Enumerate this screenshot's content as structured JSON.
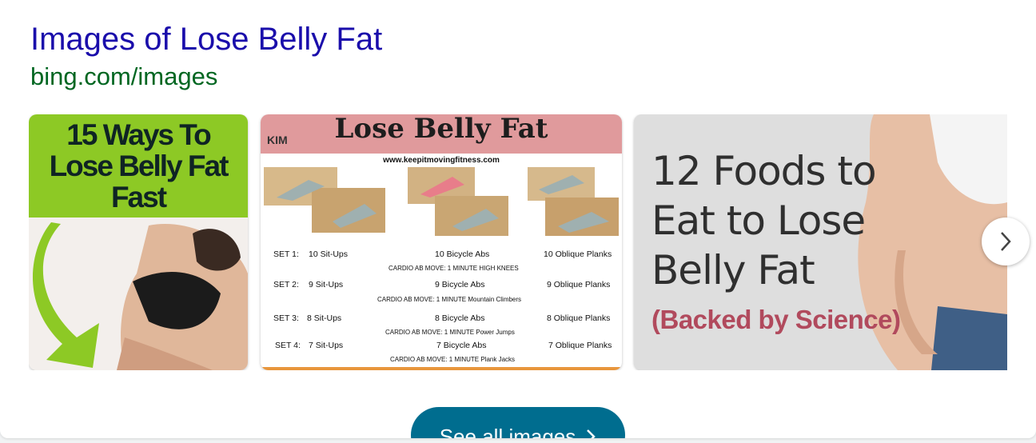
{
  "result": {
    "title": "Images of Lose Belly Fat",
    "url": "bing.com/images"
  },
  "thumbnails": [
    {
      "lines": [
        "15 Ways To",
        "Lose Belly Fat",
        "Fast"
      ]
    },
    {
      "heading": "Lose Belly Fat",
      "site": "www.keepitmovingfitness.com",
      "logo": "KIM",
      "sets": [
        {
          "label": "SET 1:",
          "a": "10 Sit-Ups",
          "b": "10 Bicycle Abs",
          "c": "10 Oblique Planks",
          "cardio": "CARDIO AB MOVE: 1 MINUTE  HIGH KNEES"
        },
        {
          "label": "SET 2:",
          "a": "9 Sit-Ups",
          "b": "9 Bicycle Abs",
          "c": "9 Oblique Planks",
          "cardio": "CARDIO AB MOVE: 1 MINUTE  Mountain Climbers"
        },
        {
          "label": "SET 3:",
          "a": "8 Sit-Ups",
          "b": "8 Bicycle Abs",
          "c": "8 Oblique Planks",
          "cardio": "CARDIO AB MOVE: 1 MINUTE  Power Jumps"
        },
        {
          "label": "SET 4:",
          "a": "7 Sit-Ups",
          "b": "7 Bicycle Abs",
          "c": "7 Oblique Planks",
          "cardio": "CARDIO AB MOVE: 1 MINUTE  Plank Jacks"
        }
      ]
    },
    {
      "lines": [
        "12 Foods to",
        "Eat to Lose",
        "Belly Fat"
      ],
      "sub": "(Backed by Science)"
    }
  ],
  "see_all": {
    "label": "See all images"
  },
  "icons": {
    "next": "chevron-right-icon",
    "see_all": "chevron-right-icon"
  },
  "colors": {
    "title": "#1a0dab",
    "url": "#006621",
    "button": "#006d8f"
  }
}
